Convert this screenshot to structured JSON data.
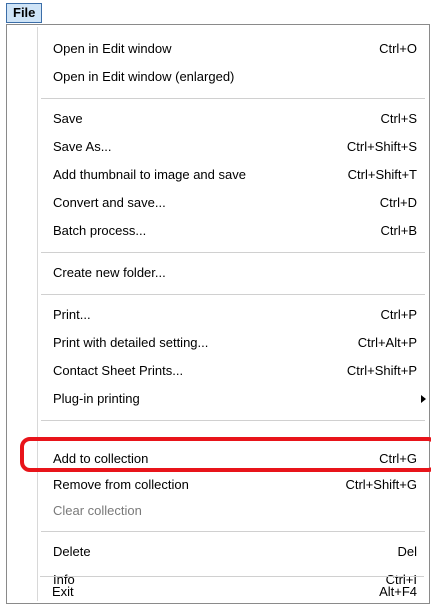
{
  "menubar": {
    "file_label": "File"
  },
  "menu": {
    "items": [
      {
        "label": "Open in Edit window",
        "shortcut": "Ctrl+O"
      },
      {
        "label": "Open in Edit window (enlarged)",
        "shortcut": ""
      },
      {
        "label": "Save",
        "shortcut": "Ctrl+S"
      },
      {
        "label": "Save As...",
        "shortcut": "Ctrl+Shift+S"
      },
      {
        "label": "Add thumbnail to image and save",
        "shortcut": "Ctrl+Shift+T"
      },
      {
        "label": "Convert and save...",
        "shortcut": "Ctrl+D"
      },
      {
        "label": "Batch process...",
        "shortcut": "Ctrl+B"
      },
      {
        "label": "Create new folder...",
        "shortcut": ""
      },
      {
        "label": "Print...",
        "shortcut": "Ctrl+P"
      },
      {
        "label": "Print with detailed setting...",
        "shortcut": "Ctrl+Alt+P"
      },
      {
        "label": "Contact Sheet Prints...",
        "shortcut": "Ctrl+Shift+P"
      },
      {
        "label": "Plug-in printing",
        "shortcut": ""
      },
      {
        "label": "Add to collection",
        "shortcut": "Ctrl+G"
      },
      {
        "label": "Remove from collection",
        "shortcut": "Ctrl+Shift+G"
      },
      {
        "label": "Clear collection",
        "shortcut": ""
      },
      {
        "label": "Delete",
        "shortcut": "Del"
      },
      {
        "label": "Info",
        "shortcut": "Ctrl+I"
      },
      {
        "label": "Exit",
        "shortcut": "Alt+F4"
      }
    ]
  },
  "annotation": {
    "highlight_color": "#e8141a",
    "highlighted_item": "Add to collection"
  }
}
